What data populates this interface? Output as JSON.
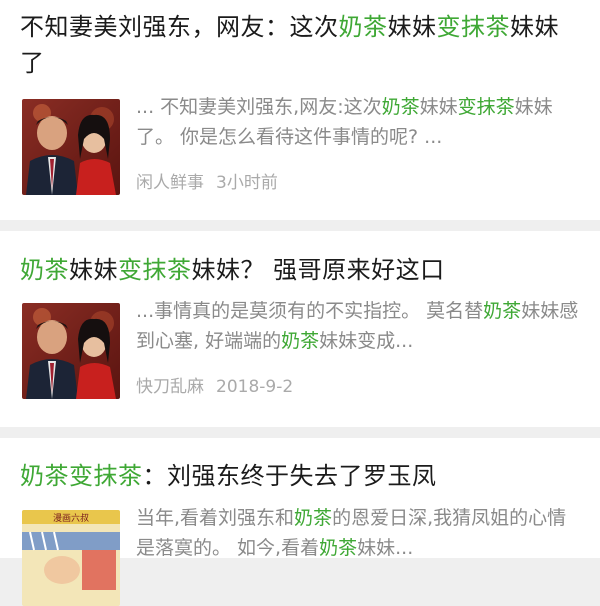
{
  "articles": [
    {
      "title_parts": [
        {
          "text": "不知妻美刘强东，网友：这次",
          "hl": false
        },
        {
          "text": "奶茶",
          "hl": true
        },
        {
          "text": "妹妹",
          "hl": false
        },
        {
          "text": "变抹茶",
          "hl": true
        },
        {
          "text": "妹妹了",
          "hl": false
        }
      ],
      "snippet_parts": [
        {
          "text": "... 不知妻美刘强东,网友:这次",
          "hl": false
        },
        {
          "text": "奶茶",
          "hl": true
        },
        {
          "text": "妹妹",
          "hl": false
        },
        {
          "text": "变抹茶",
          "hl": true
        },
        {
          "text": "妹妹了。 你是怎么看待这件事情的呢? ...",
          "hl": false
        }
      ],
      "source": "闲人鲜事",
      "time": "3小时前"
    },
    {
      "title_parts": [
        {
          "text": "奶茶",
          "hl": true
        },
        {
          "text": "妹妹",
          "hl": false
        },
        {
          "text": "变抹茶",
          "hl": true
        },
        {
          "text": "妹妹？ 强哥原来好这口",
          "hl": false
        }
      ],
      "snippet_parts": [
        {
          "text": "...事情真的是莫须有的不实指控。 莫名替",
          "hl": false
        },
        {
          "text": "奶茶",
          "hl": true
        },
        {
          "text": "妹妹感到心塞, 好端端的",
          "hl": false
        },
        {
          "text": "奶茶",
          "hl": true
        },
        {
          "text": "妹妹变成...",
          "hl": false
        }
      ],
      "source": "快刀乱麻",
      "time": "2018-9-2"
    },
    {
      "title_parts": [
        {
          "text": "奶茶变抹茶",
          "hl": true
        },
        {
          "text": "：刘强东终于失去了罗玉凤",
          "hl": false
        }
      ],
      "snippet_parts": [
        {
          "text": "当年,看着刘强东和",
          "hl": false
        },
        {
          "text": "奶茶",
          "hl": true
        },
        {
          "text": "的恩爱日深,我猜凤姐的心情是落寞的。 如今,看着",
          "hl": false
        },
        {
          "text": "奶茶",
          "hl": true
        },
        {
          "text": "妹妹...",
          "hl": false
        }
      ],
      "thumb_caption": "漫画六叔"
    }
  ],
  "colors": {
    "highlight": "#3fa835",
    "text": "#1b1b1b",
    "muted": "#8a8a8a"
  }
}
